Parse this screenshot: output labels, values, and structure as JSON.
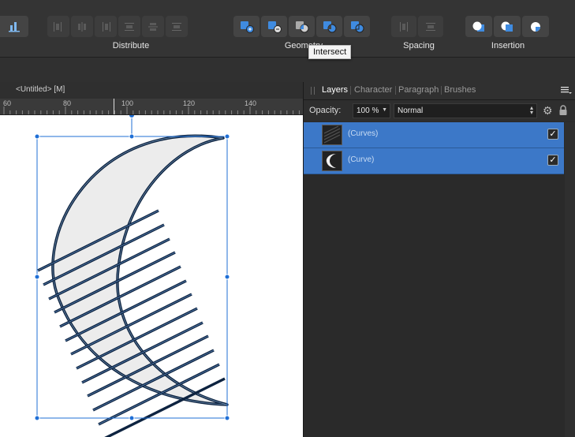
{
  "toolbar": {
    "groups": [
      {
        "label": "Distribute",
        "icons": [
          "distribute-left-icon",
          "distribute-hcenter-icon",
          "distribute-right-icon",
          "distribute-top-icon",
          "distribute-vcenter-icon",
          "distribute-bottom-icon"
        ]
      },
      {
        "label": "Geometry",
        "icons": [
          "add-icon",
          "subtract-icon",
          "intersect-icon",
          "xor-icon",
          "divide-icon"
        ]
      },
      {
        "label": "Spacing",
        "icons": [
          "spacing-horizontal-icon",
          "spacing-vertical-icon"
        ]
      },
      {
        "label": "Insertion",
        "icons": [
          "insert-behind-icon",
          "insert-inside-icon",
          "insert-top-icon"
        ]
      }
    ],
    "stub_icon": "bar-chart-icon"
  },
  "tooltip": {
    "text": "Intersect"
  },
  "document": {
    "title": "<Untitled> [M]"
  },
  "ruler": {
    "ticks": [
      "60",
      "80",
      "100",
      "120",
      "140"
    ]
  },
  "panel": {
    "tabs": [
      "Layers",
      "Character",
      "Paragraph",
      "Brushes"
    ],
    "active_tab": "Layers",
    "menu_icon": "panel-menu-icon"
  },
  "opacity": {
    "label": "Opacity:",
    "value": "100 %",
    "blend_mode": "Normal"
  },
  "layers": [
    {
      "name": "(Curves)",
      "visible": true,
      "selected": true
    },
    {
      "name": "(Curve)",
      "visible": true,
      "selected": true
    }
  ],
  "colors": {
    "accent": "#3c78c8",
    "selection": "#1f6fd6",
    "shape_fill": "#ececec",
    "stroke": "#0d2340"
  }
}
